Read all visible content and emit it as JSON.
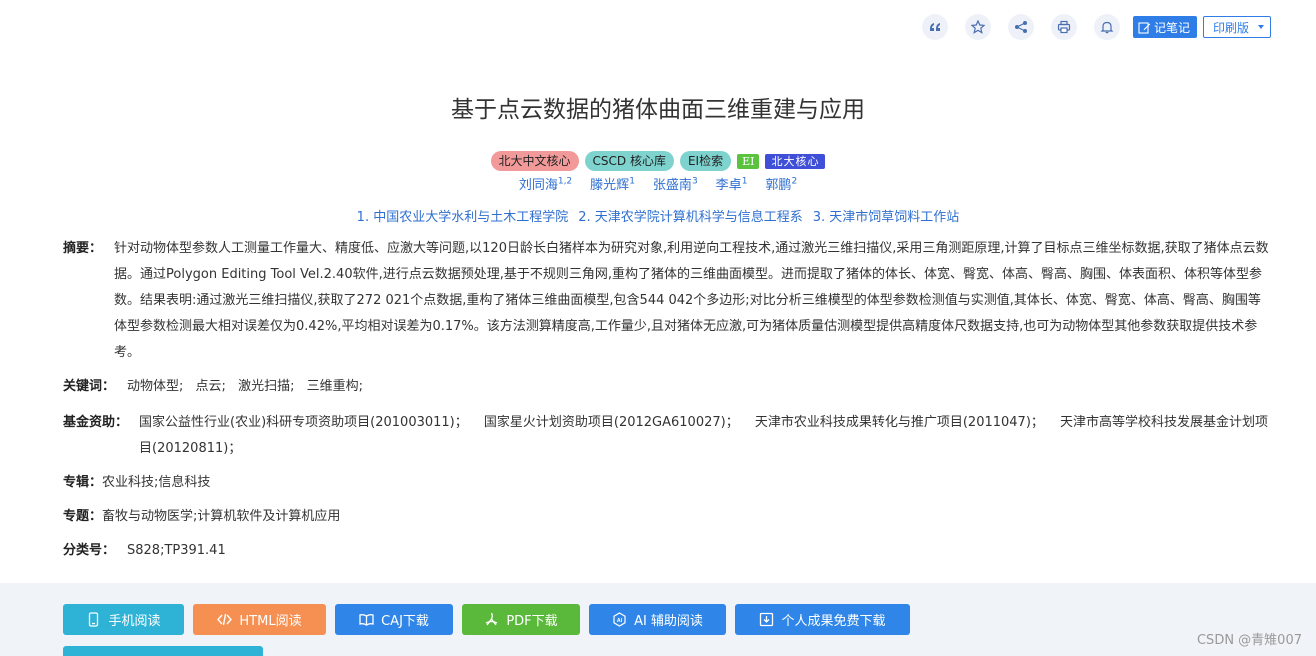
{
  "toolbar": {
    "icons": [
      "quote-icon",
      "star-icon",
      "share-icon",
      "printer-icon",
      "bell-icon"
    ],
    "note_label": "记笔记",
    "print_label": "印刷版"
  },
  "article": {
    "title": "基于点云数据的猪体曲面三维重建与应用",
    "badges": [
      "北大中文核心",
      "CSCD 核心库",
      "EI检索",
      "EI",
      "北大核心"
    ],
    "authors": [
      {
        "name": "刘同海",
        "sup": "1,2"
      },
      {
        "name": "滕光辉",
        "sup": "1"
      },
      {
        "name": "张盛南",
        "sup": "3"
      },
      {
        "name": "李卓",
        "sup": "1"
      },
      {
        "name": "郭鹏",
        "sup": "2"
      }
    ],
    "affiliations": [
      "1. 中国农业大学水利与土木工程学院",
      "2. 天津农学院计算机科学与信息工程系",
      "3. 天津市饲草饲料工作站"
    ],
    "abstract_label": "摘要：",
    "abstract": "针对动物体型参数人工测量工作量大、精度低、应激大等问题,以120日龄长白猪样本为研究对象,利用逆向工程技术,通过激光三维扫描仪,采用三角测距原理,计算了目标点三维坐标数据,获取了猪体点云数据。通过Polygon Editing Tool Vel.2.40软件,进行点云数据预处理,基于不规则三角网,重构了猪体的三维曲面模型。进而提取了猪体的体长、体宽、臀宽、体高、臀高、胸围、体表面积、体积等体型参数。结果表明:通过激光三维扫描仪,获取了272 021个点数据,重构了猪体三维曲面模型,包含544 042个多边形;对比分析三维模型的体型参数检测值与实测值,其体长、体宽、臀宽、体高、臀高、胸围等体型参数检测最大相对误差仅为0.42%,平均相对误差为0.17%。该方法测算精度高,工作量少,且对猪体无应激,可为猪体质量估测模型提供高精度体尺数据支持,也可为动物体型其他参数获取提供技术参考。",
    "keywords_label": "关键词：",
    "keywords": [
      "动物体型;",
      "点云;",
      "激光扫描;",
      "三维重构;"
    ],
    "fund_label": "基金资助：",
    "funds": [
      "国家公益性行业(农业)科研专项资助项目(201003011)；",
      "国家星火计划资助项目(2012GA610027)；",
      "天津市农业科技成果转化与推广项目(2011047)；",
      "天津市高等学校科技发展基金计划项目(20120811)；"
    ],
    "album_label": "专辑：",
    "album": "农业科技;信息科技",
    "topic_label": "专题：",
    "topic": "畜牧与动物医学;计算机软件及计算机应用",
    "clc_label": "分类号：",
    "clc": "S828;TP391.41"
  },
  "downloads": {
    "mobile": "手机阅读",
    "html": "HTML阅读",
    "caj": "CAJ下载",
    "pdf": "PDF下载",
    "ai": "AI 辅助阅读",
    "free": "个人成果免费下载"
  },
  "watermark": "CSDN @青雉007",
  "colors": {
    "link": "#2f6fd0",
    "primary": "#2f7ee8",
    "mobile": "#2eb3d6",
    "html": "#f59052",
    "pdf": "#5ab83a"
  }
}
